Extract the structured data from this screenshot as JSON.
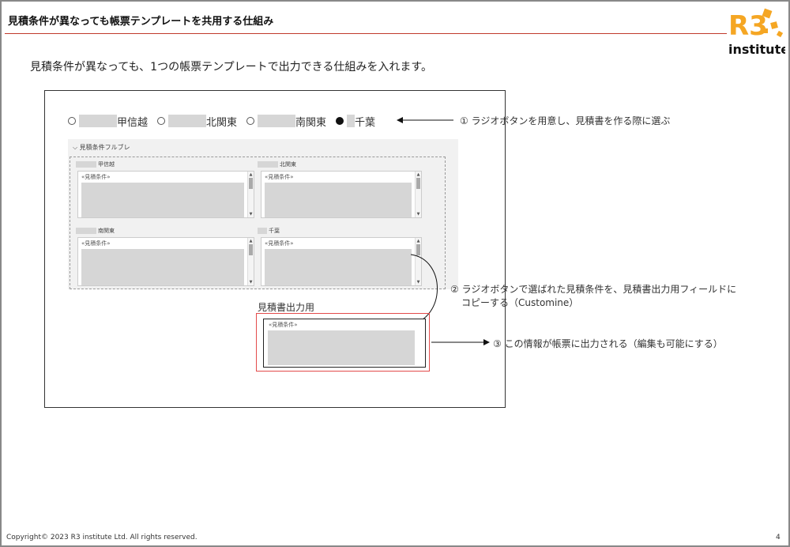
{
  "header": {
    "title": "見積条件が異なっても帳票テンプレートを共用する仕組み",
    "logo_text": "R3",
    "logo_sub": "institute",
    "accent_color": "#c0392b",
    "logo_color": "#f5a623"
  },
  "subtitle": "見積条件が異なっても、1つの帳票テンプレートで出力できる仕組みを入れます。",
  "radio_options": [
    {
      "label": "甲信越",
      "selected": false
    },
    {
      "label": "北関東",
      "selected": false
    },
    {
      "label": "南関東",
      "selected": false
    },
    {
      "label": "千葉",
      "selected": true
    }
  ],
  "panel": {
    "header": "見積条件フルブレ",
    "fields": [
      {
        "label": "甲信越",
        "tag": "«見積条件»"
      },
      {
        "label": "北関東",
        "tag": "«見積条件»"
      },
      {
        "label": "南関東",
        "tag": "«見積条件»"
      },
      {
        "label": "千葉",
        "tag": "«見積条件»"
      }
    ]
  },
  "output": {
    "label": "見積書出力用",
    "tag": "«見積条件»"
  },
  "notes": {
    "note1": "① ラジオボタンを用意し、見積書を作る際に選ぶ",
    "note2_line1": "② ラジオボタンで選ばれた見積条件を、見積書出力用フィールドに",
    "note2_line2": "コピーする（Customine）",
    "note3": "③ この情報が帳票に出力される（編集も可能にする）"
  },
  "footer": {
    "copyright": "Copyright© 2023 R3 institute Ltd. All rights reserved.",
    "page_number": "4"
  }
}
